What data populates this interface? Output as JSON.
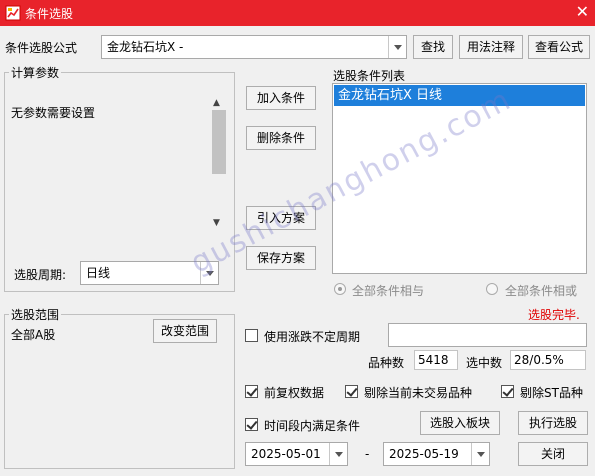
{
  "window": {
    "title": "条件选股",
    "close_glyph": "✕"
  },
  "formula": {
    "label": "条件选股公式",
    "value": "金龙钻石坑X  -",
    "find_button": "查找",
    "usage_button": "用法注释",
    "view_button": "查看公式"
  },
  "params": {
    "legend": "计算参数",
    "message": "无参数需要设置",
    "period_label": "选股周期:",
    "period_value": "日线"
  },
  "actions": {
    "add": "加入条件",
    "delete": "删除条件",
    "import": "引入方案",
    "save": "保存方案"
  },
  "conditions": {
    "label": "选股条件列表",
    "items": [
      "金龙钻石坑X  日线"
    ],
    "and_label": "全部条件相与",
    "or_label": "全部条件相或",
    "status": "选股完毕.",
    "status_color": "#e00000",
    "selection_color": "#1e7fdb"
  },
  "scope": {
    "legend": "选股范围",
    "value": "全部A股",
    "change_button": "改变范围"
  },
  "options": {
    "variable_period_label": "使用涨跌不定周期",
    "variable_period_checked": false,
    "stock_count_label": "品种数",
    "stock_count": "5418",
    "selected_label": "选中数",
    "selected_value": "28/0.5%",
    "forward_adjust_label": "前复权数据",
    "forward_adjust_checked": true,
    "remove_untraded_label": "剔除当前未交易品种",
    "remove_untraded_checked": true,
    "remove_st_label": "剔除ST品种",
    "remove_st_checked": true,
    "time_range_label": "时间段内满足条件",
    "time_range_checked": true,
    "to_block_button": "选股入板块",
    "execute_button": "执行选股",
    "close_button": "关闭",
    "start_date": "2025-05-01",
    "end_date": "2025-05-19",
    "date_separator": "-"
  },
  "watermark": "gushichanghong.com"
}
